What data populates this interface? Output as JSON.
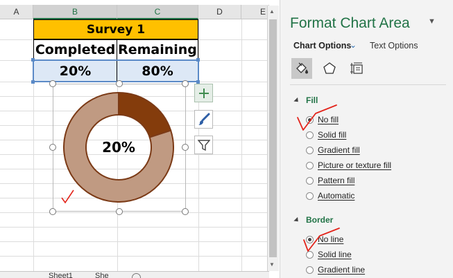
{
  "columns": [
    "A",
    "B",
    "C",
    "D",
    "E"
  ],
  "table": {
    "title": "Survey 1",
    "headers": [
      "Completed",
      "Remaining"
    ],
    "values": [
      "20%",
      "80%"
    ]
  },
  "chart": {
    "center_label": "20%",
    "completed_fraction": 0.2,
    "remaining_fraction": 0.8,
    "completed_color": "#843c0c",
    "remaining_color": "#c09a82"
  },
  "chart_tools": {
    "elements": "chart-elements-plus-icon",
    "styles": "paintbrush-icon",
    "filters": "funnel-icon"
  },
  "sheet_tabs": [
    "Sheet1",
    "She"
  ],
  "pane": {
    "title": "Format Chart Area",
    "tabs": {
      "chart_options": "Chart Options",
      "text_options": "Text Options"
    },
    "fill": {
      "header": "Fill",
      "options": [
        {
          "label": "No fill",
          "selected": true
        },
        {
          "label": "Solid fill",
          "selected": false
        },
        {
          "label": "Gradient fill",
          "selected": false
        },
        {
          "label": "Picture or texture fill",
          "selected": false
        },
        {
          "label": "Pattern fill",
          "selected": false
        },
        {
          "label": "Automatic",
          "selected": false
        }
      ]
    },
    "border": {
      "header": "Border",
      "options": [
        {
          "label": "No line",
          "selected": true
        },
        {
          "label": "Solid line",
          "selected": false
        },
        {
          "label": "Gradient line",
          "selected": false
        }
      ]
    }
  },
  "colors": {
    "accent_green": "#217346",
    "title_fill": "#ffc000",
    "value_fill": "#dde8f6",
    "annotation_red": "#e3241b"
  }
}
